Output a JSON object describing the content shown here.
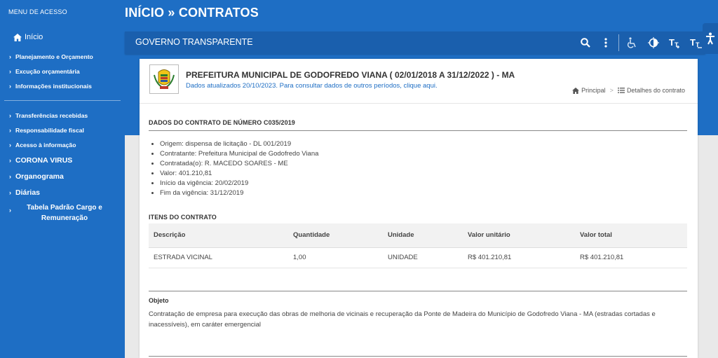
{
  "sidebar": {
    "title": "MENU DE ACESSO",
    "home_label": "Início",
    "group1": [
      {
        "label": "Planejamento e Orçamento"
      },
      {
        "label": "Excução orçamentária"
      },
      {
        "label": "Informações institucionais"
      }
    ],
    "group2": [
      {
        "label": "Transferências recebidas"
      },
      {
        "label": "Responsabilidade fiscal"
      },
      {
        "label": "Acesso à informação"
      }
    ],
    "group3": [
      {
        "label": "CORONA VIRUS"
      },
      {
        "label": "Organograma"
      },
      {
        "label": "Diárias"
      }
    ],
    "tabela_label": "Tabela Padrão Cargo e Remuneração"
  },
  "header": {
    "page_heading": "INÍCIO » CONTRATOS",
    "portal_title": "GOVERNO TRANSPARENTE",
    "tools": [
      "search-icon",
      "more-vert-icon",
      "wheelchair-icon",
      "contrast-icon",
      "font-increase-icon",
      "font-decrease-icon",
      "accessibility-icon"
    ]
  },
  "entity": {
    "title": "PREFEITURA MUNICIPAL DE GODOFREDO VIANA ( 02/01/2018 A 31/12/2022 ) - MA",
    "subtitle": "Dados atualizados 20/10/2023. Para consultar dados de outros períodos, clique aqui."
  },
  "breadcrumb": {
    "home": "Principal",
    "separator": ">",
    "current": "Detalhes do contrato"
  },
  "contract": {
    "section_title": "DADOS DO CONTRATO DE NÚMERO C035/2019",
    "details": [
      "Origem: dispensa de licitação - DL 001/2019",
      "Contratante: Prefeitura Municipal de Godofredo Viana",
      "Contratada(o): R. MACEDO SOARES - ME",
      "Valor: 401.210,81",
      "Início da vigência: 20/02/2019",
      "Fim da vigência: 31/12/2019"
    ]
  },
  "items": {
    "section_title": "ITENS DO CONTRATO",
    "columns": [
      "Descrição",
      "Quantidade",
      "Unidade",
      "Valor unitário",
      "Valor total"
    ],
    "rows": [
      [
        "ESTRADA VICINAL",
        "1,00",
        "UNIDADE",
        "R$ 401.210,81",
        "R$ 401.210,81"
      ]
    ]
  },
  "objeto": {
    "label": "Objeto",
    "text": "Contratação de empresa para execução das obras de melhoria de vicinais e recuperação da Ponte de Madeira do Município de Godofredo Viana - MA (estradas cortadas e inacessíveis), em caráter emergencial"
  },
  "colors": {
    "primary": "#1e6ec4",
    "primary_dark": "#1a5fad",
    "link": "#1e6ec4"
  }
}
